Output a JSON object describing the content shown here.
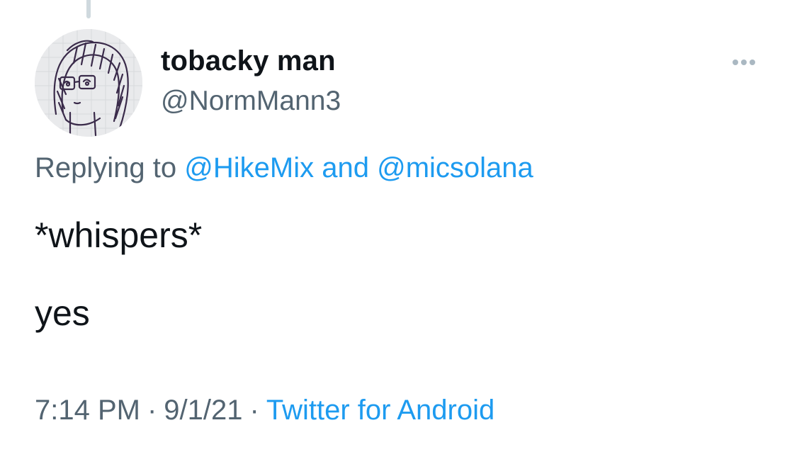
{
  "tweet": {
    "author": {
      "display_name": "tobacky man",
      "handle": "@NormMann3",
      "avatar_icon": "avatar-drawing"
    },
    "more_icon": "more-horizontal-icon",
    "reply": {
      "prefix": "Replying to",
      "mentions": [
        "@HikeMix",
        "@micsolana"
      ],
      "joiner": "and"
    },
    "text_lines": [
      "*whispers*",
      "yes"
    ],
    "meta": {
      "time": "7:14 PM",
      "separator": "·",
      "date": "9/1/21",
      "source": "Twitter for Android"
    }
  },
  "colors": {
    "text_primary": "#0f1419",
    "text_secondary": "#536471",
    "link": "#1d9bf0",
    "thread_line": "#cfd9de",
    "more_dots": "#aab8c2"
  }
}
